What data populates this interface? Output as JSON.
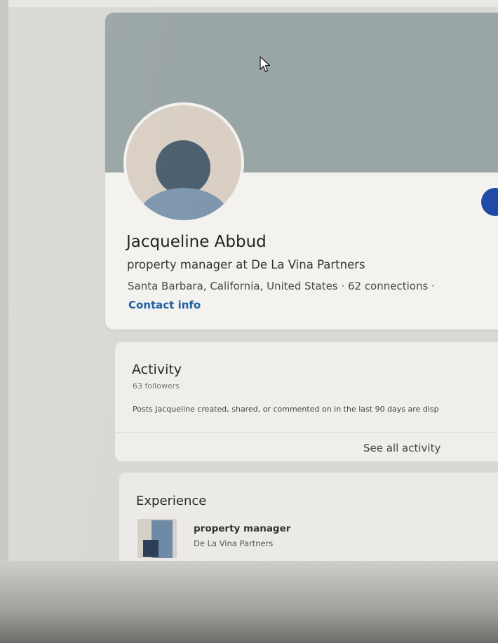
{
  "profile": {
    "name": "Jacqueline Abbud",
    "headline": "property manager at De La Vina Partners",
    "location": "Santa Barbara, California, United States",
    "connections": "62 connections",
    "location_line": "Santa Barbara, California, United States · 62 connections ·",
    "contact_info": "Contact info"
  },
  "activity": {
    "title": "Activity",
    "followers": "63 followers",
    "description": "Posts Jacqueline created, shared, or commented on in the last 90 days are disp",
    "see_all": "See all activity"
  },
  "experience": {
    "title": "Experience",
    "items": [
      {
        "role": "property manager",
        "company": "De La Vina Partners"
      }
    ]
  },
  "colors": {
    "banner": "#9aa5a6",
    "link": "#1d5fa8",
    "accent_button": "#1f4aa8"
  },
  "icons": [
    "mouse-pointer-icon",
    "default-avatar-icon",
    "company-logo-icon"
  ]
}
